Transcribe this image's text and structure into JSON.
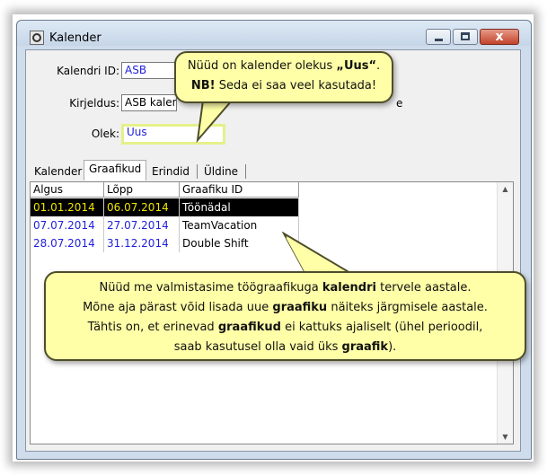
{
  "window": {
    "title": "Kalender",
    "buttons": {
      "minimize": "minimize",
      "maximize": "maximize",
      "close": "x"
    }
  },
  "form": {
    "calendar_id": {
      "label": "Kalendri ID:",
      "value": "ASB"
    },
    "description": {
      "label": "Kirjeldus:",
      "value": "ASB kalender 2014",
      "trailing_fragment": "e"
    },
    "status": {
      "label": "Olek:",
      "value": "Uus"
    }
  },
  "tabs": [
    "Kalender",
    "Graafikud",
    "Erindid",
    "Üldine"
  ],
  "active_tab": "Graafikud",
  "table": {
    "columns": [
      "Algus",
      "Lõpp",
      "Graafiku ID"
    ],
    "rows": [
      {
        "start": "01.01.2014",
        "end": "06.07.2014",
        "schedule": "Töönädal",
        "selected": true
      },
      {
        "start": "07.07.2014",
        "end": "27.07.2014",
        "schedule": "TeamVacation",
        "selected": false
      },
      {
        "start": "28.07.2014",
        "end": "31.12.2014",
        "schedule": "Double Shift",
        "selected": false
      }
    ]
  },
  "callouts": {
    "top": {
      "l1a": "Nüüd on kalender olekus ",
      "l1b": "„Uus“",
      "l1c": ".",
      "l2a": "NB!",
      "l2b": " Seda ei saa veel kasutada!"
    },
    "bottom": {
      "l1a": "Nüüd me valmistasime töögraafikuga ",
      "l1b": "kalendri",
      "l1c": " tervele aastale.",
      "l2a": "Mõne aja pärast võid lisada uue ",
      "l2b": "graafiku",
      "l2c": " näiteks järgmisele aastale.",
      "l3a": "Tähtis on, et erinevad ",
      "l3b": "graafikud",
      "l3c": " ei kattuks ajaliselt (ühel perioodil,",
      "l4a": "saab kasutusel olla vaid üks ",
      "l4b": "graafik",
      "l4c": ")."
    }
  },
  "colors": {
    "callout_bg": "#ffffa8",
    "highlight_border": "#e6f08a",
    "date_blue": "#1f1fdc",
    "selected_date": "#f0e400"
  }
}
